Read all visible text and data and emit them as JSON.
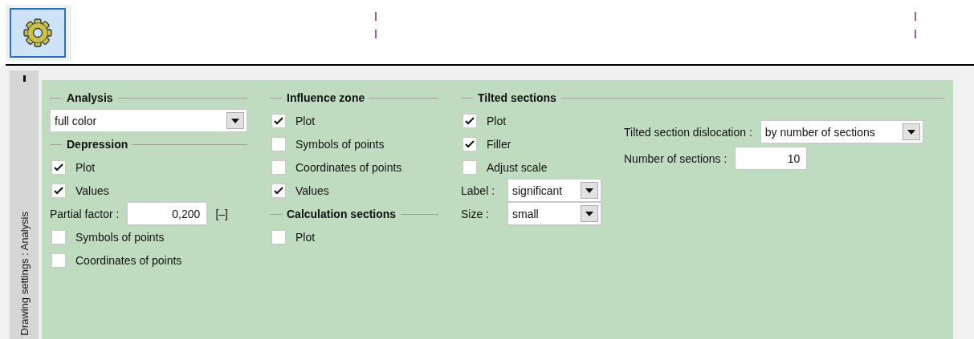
{
  "toolbar": {
    "settings_button": {
      "selected": true
    }
  },
  "side_tab": {
    "label": "Drawing settings : Analysis"
  },
  "analysis": {
    "title": "Analysis",
    "items": [
      {
        "kind": "dropdown",
        "value": "full color"
      }
    ]
  },
  "depression": {
    "title": "Depression",
    "items": [
      {
        "kind": "checkbox",
        "label": "Plot",
        "checked": true
      },
      {
        "kind": "checkbox",
        "label": "Values",
        "checked": true
      },
      {
        "kind": "field",
        "label": "Partial factor :",
        "value": "0,200",
        "unit": "[–]"
      },
      {
        "kind": "checkbox",
        "label": "Symbols of points",
        "checked": false
      },
      {
        "kind": "checkbox",
        "label": "Coordinates of points",
        "checked": false
      }
    ]
  },
  "influence_zone": {
    "title": "Influence zone",
    "items": [
      {
        "kind": "checkbox",
        "label": "Plot",
        "checked": true
      },
      {
        "kind": "checkbox",
        "label": "Symbols of points",
        "checked": false
      },
      {
        "kind": "checkbox",
        "label": "Coordinates of points",
        "checked": false
      },
      {
        "kind": "checkbox",
        "label": "Values",
        "checked": true
      }
    ]
  },
  "calculation_sections": {
    "title": "Calculation sections",
    "items": [
      {
        "kind": "checkbox",
        "label": "Plot",
        "checked": false
      }
    ]
  },
  "tilted_sections": {
    "title": "Tilted sections",
    "items": [
      {
        "kind": "checkbox",
        "label": "Plot",
        "checked": true
      },
      {
        "kind": "checkbox",
        "label": "Filler",
        "checked": true
      },
      {
        "kind": "checkbox",
        "label": "Adjust scale",
        "checked": false
      },
      {
        "kind": "dropdown",
        "label": "Label :",
        "value": "significant"
      },
      {
        "kind": "dropdown",
        "label": "Size :",
        "value": "small"
      }
    ],
    "side_items": [
      {
        "kind": "dropdown",
        "label": "Tilted section dislocation :",
        "value": "by number of sections"
      },
      {
        "kind": "field",
        "label": "Number of sections :",
        "value": "10"
      }
    ]
  }
}
